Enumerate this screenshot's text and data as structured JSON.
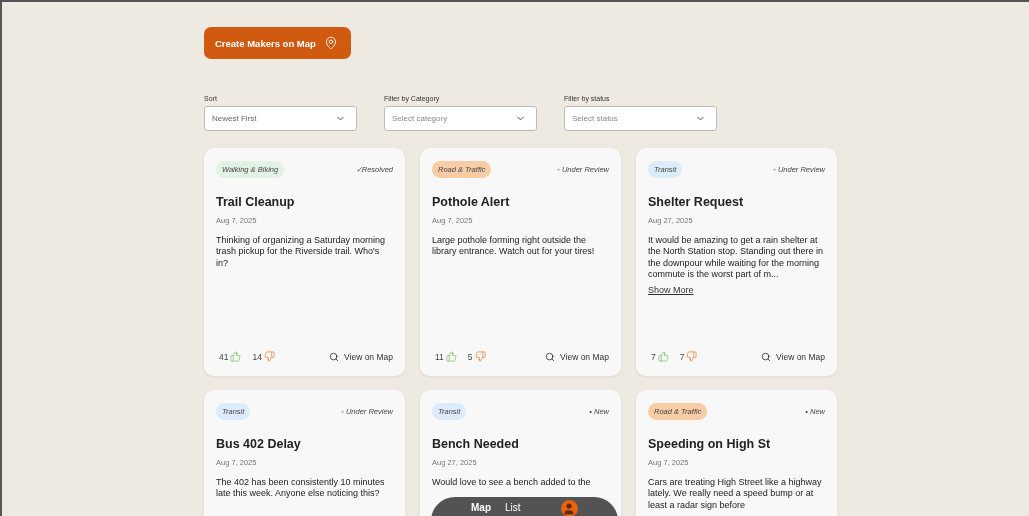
{
  "create_button": {
    "label": "Create Makers on Map"
  },
  "filters": [
    {
      "label": "Sort",
      "value": "Newest First"
    },
    {
      "label": "Filter by Category",
      "placeholder": "Select category"
    },
    {
      "label": "Filter by status",
      "placeholder": "Select status"
    }
  ],
  "cards": [
    {
      "category": "Walking & Biking",
      "color": "#e2f2e4",
      "status": "✓Resolved",
      "title": "Trail Cleanup",
      "date": "Aug 7, 2025",
      "body": "Thinking of organizing a Saturday morning trash pickup for the Riverside trail. Who's in?",
      "upvotes": "41",
      "downvotes": "14",
      "action": "View on Map"
    },
    {
      "category": "Road & Traffic",
      "color": "#f8cda6",
      "status": "◦ Under Review",
      "title": "Pothole Alert",
      "date": "Aug 7, 2025",
      "body": "Large pothole forming right outside the library entrance. Watch out for your tires!",
      "upvotes": "11",
      "downvotes": "5",
      "action": "View on Map"
    },
    {
      "category": "Transit",
      "color": "#ddecfa",
      "status": "◦ Under Review",
      "title": "Shelter Request",
      "date": "Aug 27, 2025",
      "body": "It would be amazing to get a rain shelter at the North Station stop. Standing out there in the downpour while waiting for the morning commute is the worst part of m...",
      "show_more": "Show More",
      "upvotes": "7",
      "downvotes": "7",
      "action": "View on Map"
    },
    {
      "category": "Transit",
      "color": "#ddecfa",
      "status": "◦ Under Review",
      "title": "Bus 402 Delay",
      "date": "Aug 7, 2025",
      "body": "The 402 has been consistently 10 minutes late this week. Anyone else noticing this?"
    },
    {
      "category": "Transit",
      "color": "#ddecfa",
      "status": "• New",
      "title": "Bench Needed",
      "date": "Aug 27, 2025",
      "body": "Would love to see a bench added to the"
    },
    {
      "category": "Road & Traffic",
      "color": "#f8cda6",
      "status": "• New",
      "title": "Speeding on High St",
      "date": "Aug 7, 2025",
      "body": "Cars are treating High Street like a highway lately. We really need a speed bump or at least a radar sign before"
    }
  ],
  "view_switch": [
    {
      "label": "Map",
      "selected": true
    },
    {
      "label": "List",
      "selected": false
    }
  ]
}
